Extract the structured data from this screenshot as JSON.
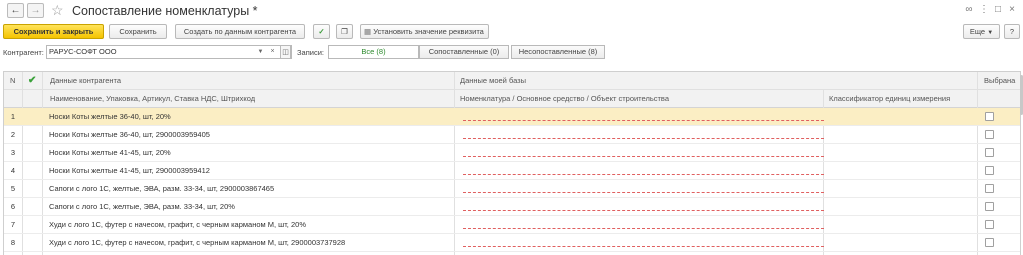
{
  "titlebar": {
    "title": "Сопоставление номенклатуры *",
    "back_icon": "arrow-left-icon",
    "forward_icon": "arrow-right-icon",
    "favorite_icon": "star-icon"
  },
  "toolbar": {
    "save_close_label": "Сохранить и закрыть",
    "save_label": "Сохранить",
    "create_by_counterparty_label": "Создать по данным контрагента",
    "set_attribute_label": "Установить значение реквизита",
    "more_label": "Еще",
    "help_label": "?"
  },
  "filter": {
    "counterparty_label": "Контрагент:",
    "counterparty_value": "РАРУС-СОФТ ООО",
    "records_label": "Записи:",
    "segments": [
      "Все (8)",
      "Сопоставленные (0)",
      "Несопоставленные (8)"
    ]
  },
  "table": {
    "header": {
      "n": "N",
      "counterparty_data": "Данные контрагента",
      "counterparty_sub": "Наименование, Упаковка, Артикул, Ставка НДС, Штрихкод",
      "my_base": "Данные моей базы",
      "my_base_sub": "Номенклатура / Основное средство / Объект строительства",
      "classifier": "Классификатор единиц измерения",
      "selected": "Выбрана"
    },
    "rows": [
      {
        "n": "1",
        "name": "Носки Коты желтые 36-40, шт, 20%"
      },
      {
        "n": "2",
        "name": "Носки Коты желтые 36-40, шт, 2900003959405"
      },
      {
        "n": "3",
        "name": "Носки Коты желтые 41-45, шт, 20%"
      },
      {
        "n": "4",
        "name": "Носки Коты желтые 41-45, шт, 2900003959412"
      },
      {
        "n": "5",
        "name": "Сапоги с лого 1С, желтые, ЭВА, разм. 33-34, шт, 2900003867465"
      },
      {
        "n": "6",
        "name": "Сапоги с лого 1С, желтые, ЭВА, разм. 33-34, шт, 20%"
      },
      {
        "n": "7",
        "name": "Худи с лого 1С, футер с начесом, графит, с черным карманом M, шт, 20%"
      },
      {
        "n": "8",
        "name": "Худи с лого 1С, футер с начесом, графит, с черным карманом M, шт, 2900003737928"
      }
    ]
  },
  "colors": {
    "primary_button": "#f5c400",
    "selected_row": "#fbeec4",
    "invalid_underline": "#e06060",
    "active_segment": "#2c8a2c"
  }
}
